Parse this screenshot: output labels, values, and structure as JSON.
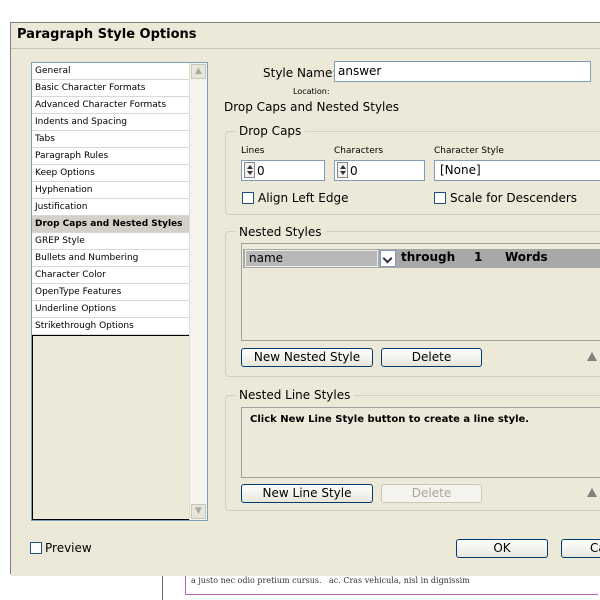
{
  "window": {
    "title": "Paragraph Style Options"
  },
  "sidebar": {
    "items": [
      {
        "label": "General",
        "selected": false
      },
      {
        "label": "Basic Character Formats",
        "selected": false
      },
      {
        "label": "Advanced Character Formats",
        "selected": false
      },
      {
        "label": "Indents and Spacing",
        "selected": false
      },
      {
        "label": "Tabs",
        "selected": false
      },
      {
        "label": "Paragraph Rules",
        "selected": false
      },
      {
        "label": "Keep Options",
        "selected": false
      },
      {
        "label": "Hyphenation",
        "selected": false
      },
      {
        "label": "Justification",
        "selected": false
      },
      {
        "label": "Drop Caps and Nested Styles",
        "selected": true
      },
      {
        "label": "GREP Style",
        "selected": false
      },
      {
        "label": "Bullets and Numbering",
        "selected": false
      },
      {
        "label": "Character Color",
        "selected": false
      },
      {
        "label": "OpenType Features",
        "selected": false
      },
      {
        "label": "Underline Options",
        "selected": false
      },
      {
        "label": "Strikethrough Options",
        "selected": false
      }
    ]
  },
  "style_name": {
    "label": "Style Name:",
    "value": "answer"
  },
  "location": {
    "label": "Location:"
  },
  "section_title": "Drop Caps and Nested Styles",
  "drop_caps": {
    "group_title": "Drop Caps",
    "lines_label": "Lines",
    "lines_value": "0",
    "characters_label": "Characters",
    "characters_value": "0",
    "char_style_label": "Character Style",
    "char_style_value": "[None]",
    "align_left_label": "Align Left Edge",
    "scale_desc_label": "Scale for Descenders"
  },
  "nested_styles": {
    "group_title": "Nested Styles",
    "row": {
      "style": "name",
      "through": "through",
      "count": "1",
      "unit": "Words"
    },
    "new_button": "New Nested Style",
    "delete_button": "Delete"
  },
  "nested_line_styles": {
    "group_title": "Nested Line Styles",
    "hint": "Click New Line Style button to create a line style.",
    "new_button": "New Line Style",
    "delete_button": "Delete"
  },
  "footer": {
    "preview_label": "Preview",
    "ok_button": "OK",
    "cancel_button": "Ca"
  },
  "background_doc": {
    "line1": "a justo nec odio pretium cursus.",
    "line2": "ac. Cras vehicula, nisl in dignissim"
  }
}
